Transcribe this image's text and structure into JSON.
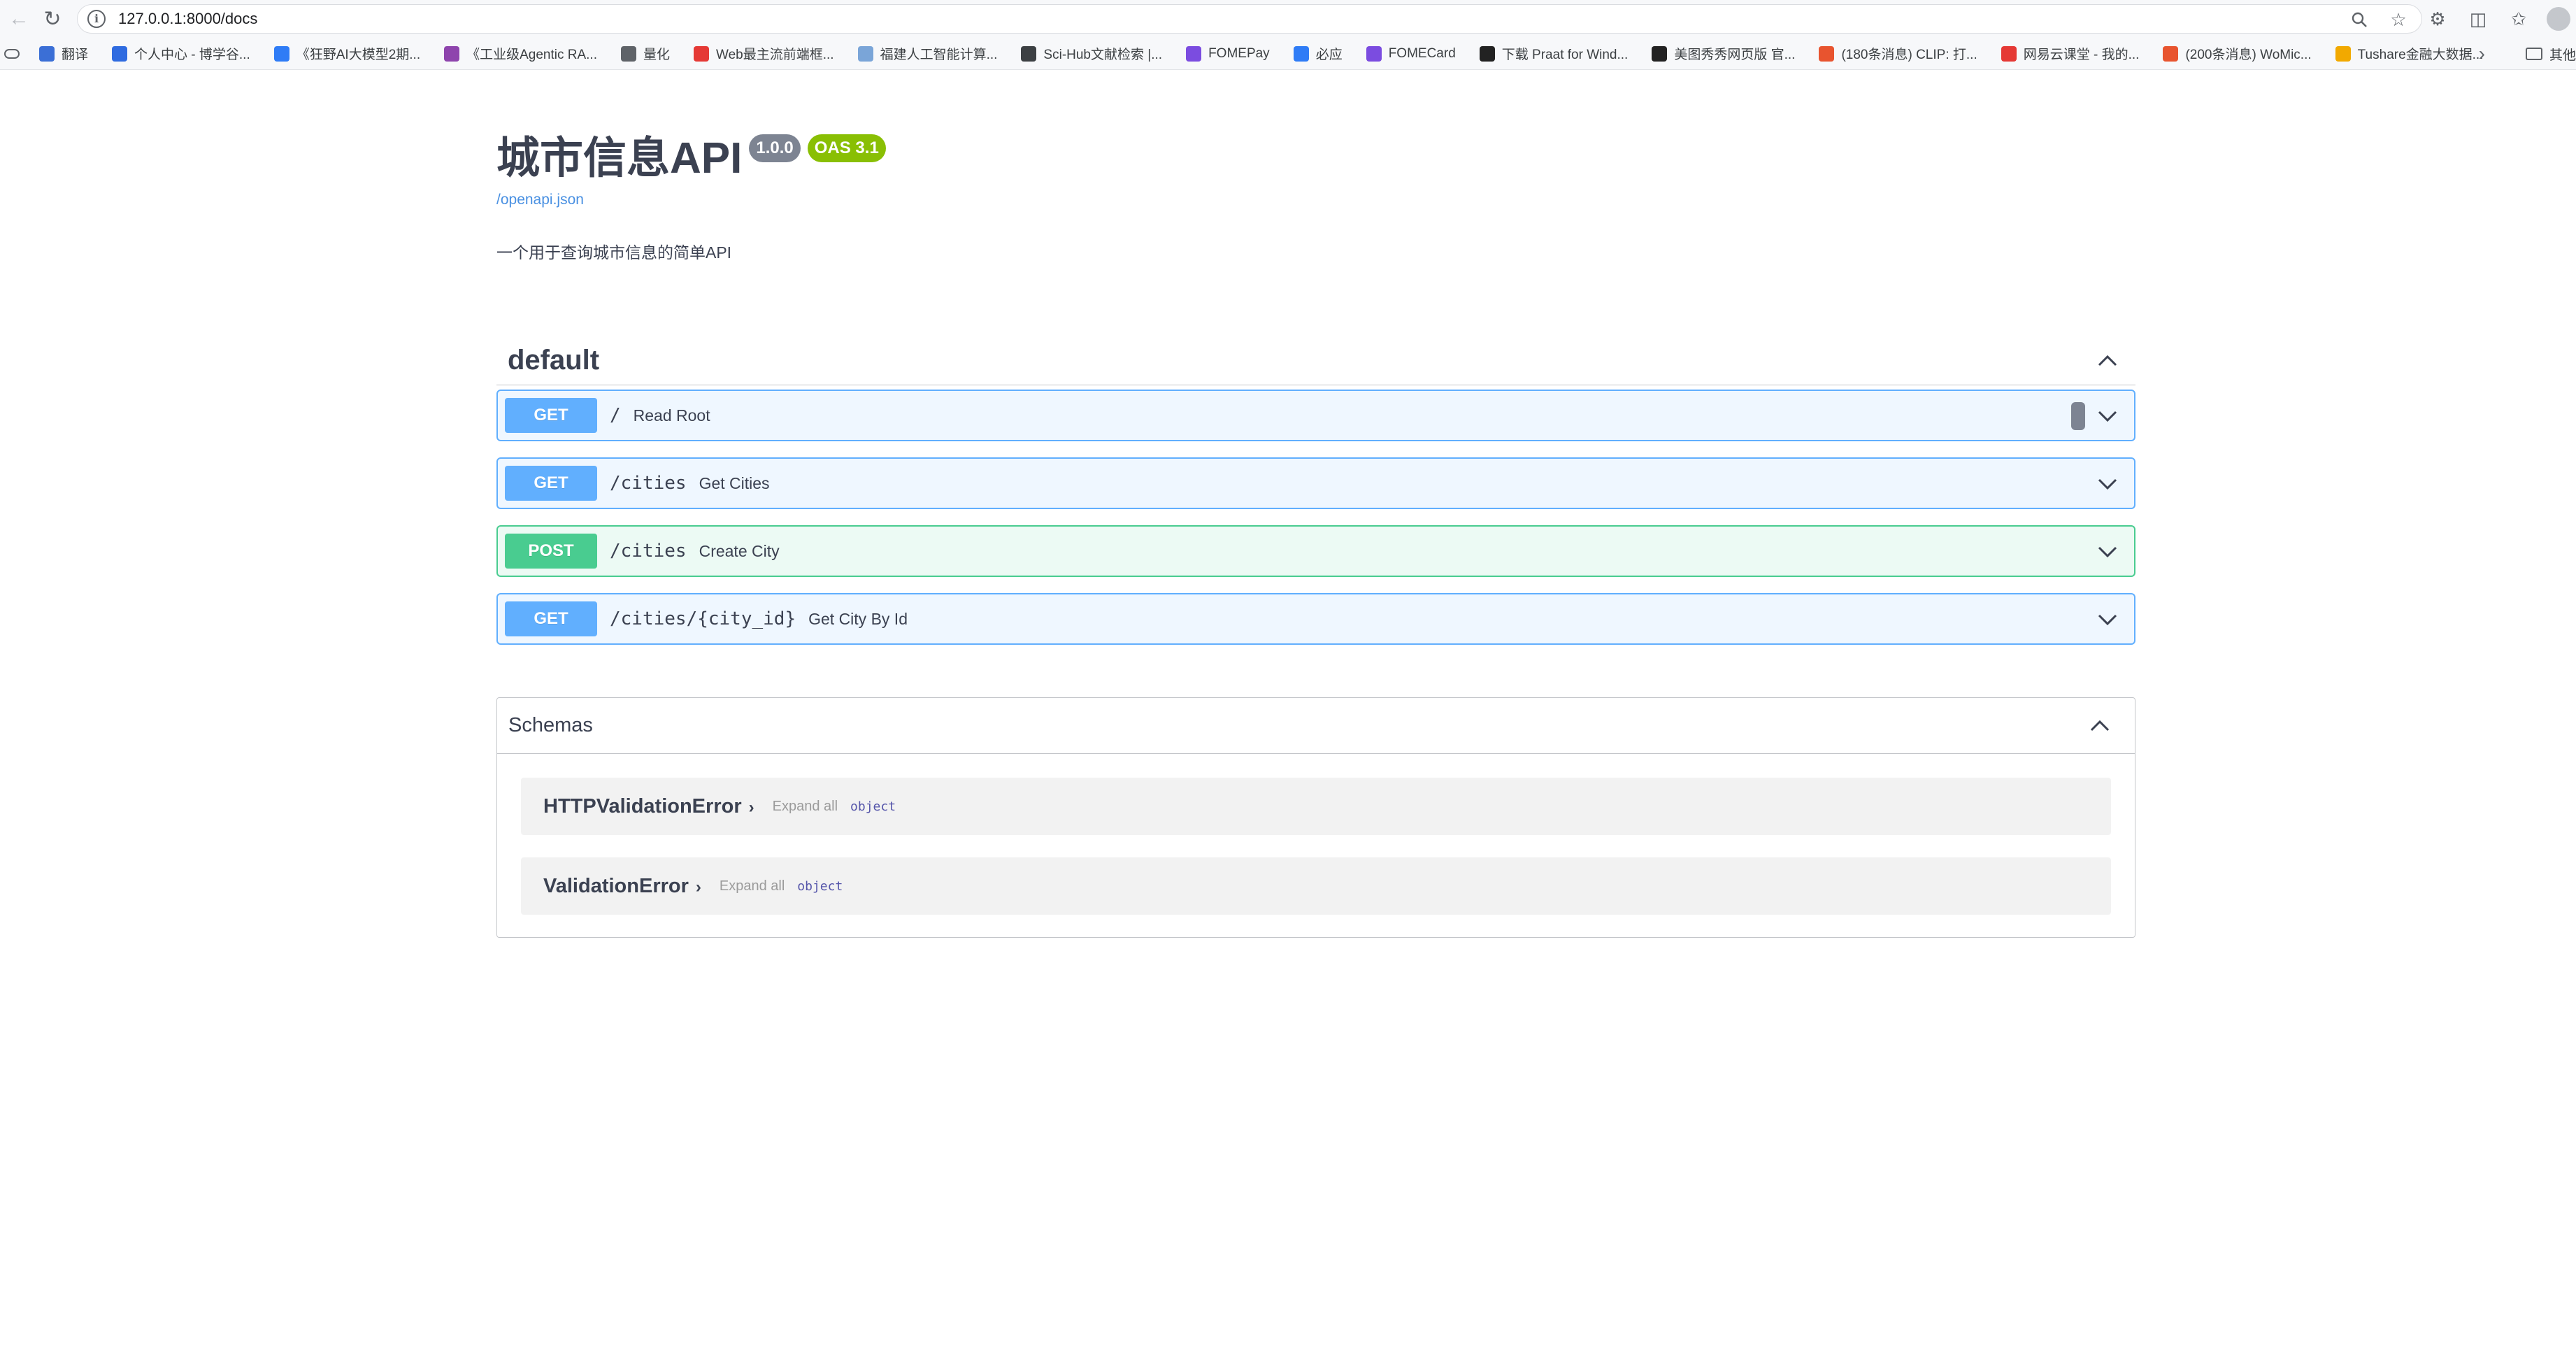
{
  "browser": {
    "url": "127.0.0.1:8000/docs",
    "bookmarks": [
      {
        "label": "翻译",
        "color": "#3b6fd6"
      },
      {
        "label": "个人中心 - 博学谷...",
        "color": "#2f6be0"
      },
      {
        "label": "《狂野AI大模型2期...",
        "color": "#2f7cf6"
      },
      {
        "label": "《工业级Agentic RA...",
        "color": "#8e44ad"
      },
      {
        "label": "量化",
        "color": "#5f6368"
      },
      {
        "label": "Web最主流前端框...",
        "color": "#e53935"
      },
      {
        "label": "福建人工智能计算...",
        "color": "#7aa5d8"
      },
      {
        "label": "Sci-Hub文献检索 |...",
        "color": "#3c4043"
      },
      {
        "label": "FOMEPay",
        "color": "#7b4ce0"
      },
      {
        "label": "必应",
        "color": "#2f7cf6"
      },
      {
        "label": "FOMECard",
        "color": "#7b4ce0"
      },
      {
        "label": "下载 Praat for Wind...",
        "color": "#222222"
      },
      {
        "label": "美图秀秀网页版 官...",
        "color": "#222222"
      },
      {
        "label": "(180条消息) CLIP: 打...",
        "color": "#e8542f"
      },
      {
        "label": "网易云课堂 - 我的...",
        "color": "#e53935"
      },
      {
        "label": "(200条消息) WoMic...",
        "color": "#e8542f"
      },
      {
        "label": "Tushare金融大数据...",
        "color": "#f2a900"
      }
    ],
    "bookmarks_more": "›",
    "other_bookmarks": "其他"
  },
  "info": {
    "title": "城市信息API",
    "version": "1.0.0",
    "oas": "OAS 3.1",
    "spec_link": "/openapi.json",
    "description": "一个用于查询城市信息的简单API"
  },
  "tag": {
    "name": "default",
    "operations": [
      {
        "method": "GET",
        "path": "/",
        "summary": "Read Root"
      },
      {
        "method": "GET",
        "path": "/cities",
        "summary": "Get Cities"
      },
      {
        "method": "POST",
        "path": "/cities",
        "summary": "Create City"
      },
      {
        "method": "GET",
        "path": "/cities/{city_id}",
        "summary": "Get City By Id"
      }
    ]
  },
  "schemas": {
    "title": "Schemas",
    "items": [
      {
        "name": "HTTPValidationError",
        "expand": "Expand all",
        "type": "object"
      },
      {
        "name": "ValidationError",
        "expand": "Expand all",
        "type": "object"
      }
    ]
  },
  "colors": {
    "get": "#61affe",
    "post": "#49cc90",
    "version_badge": "#7d8492",
    "oas_badge": "#89bf04",
    "link": "#4990e2"
  }
}
